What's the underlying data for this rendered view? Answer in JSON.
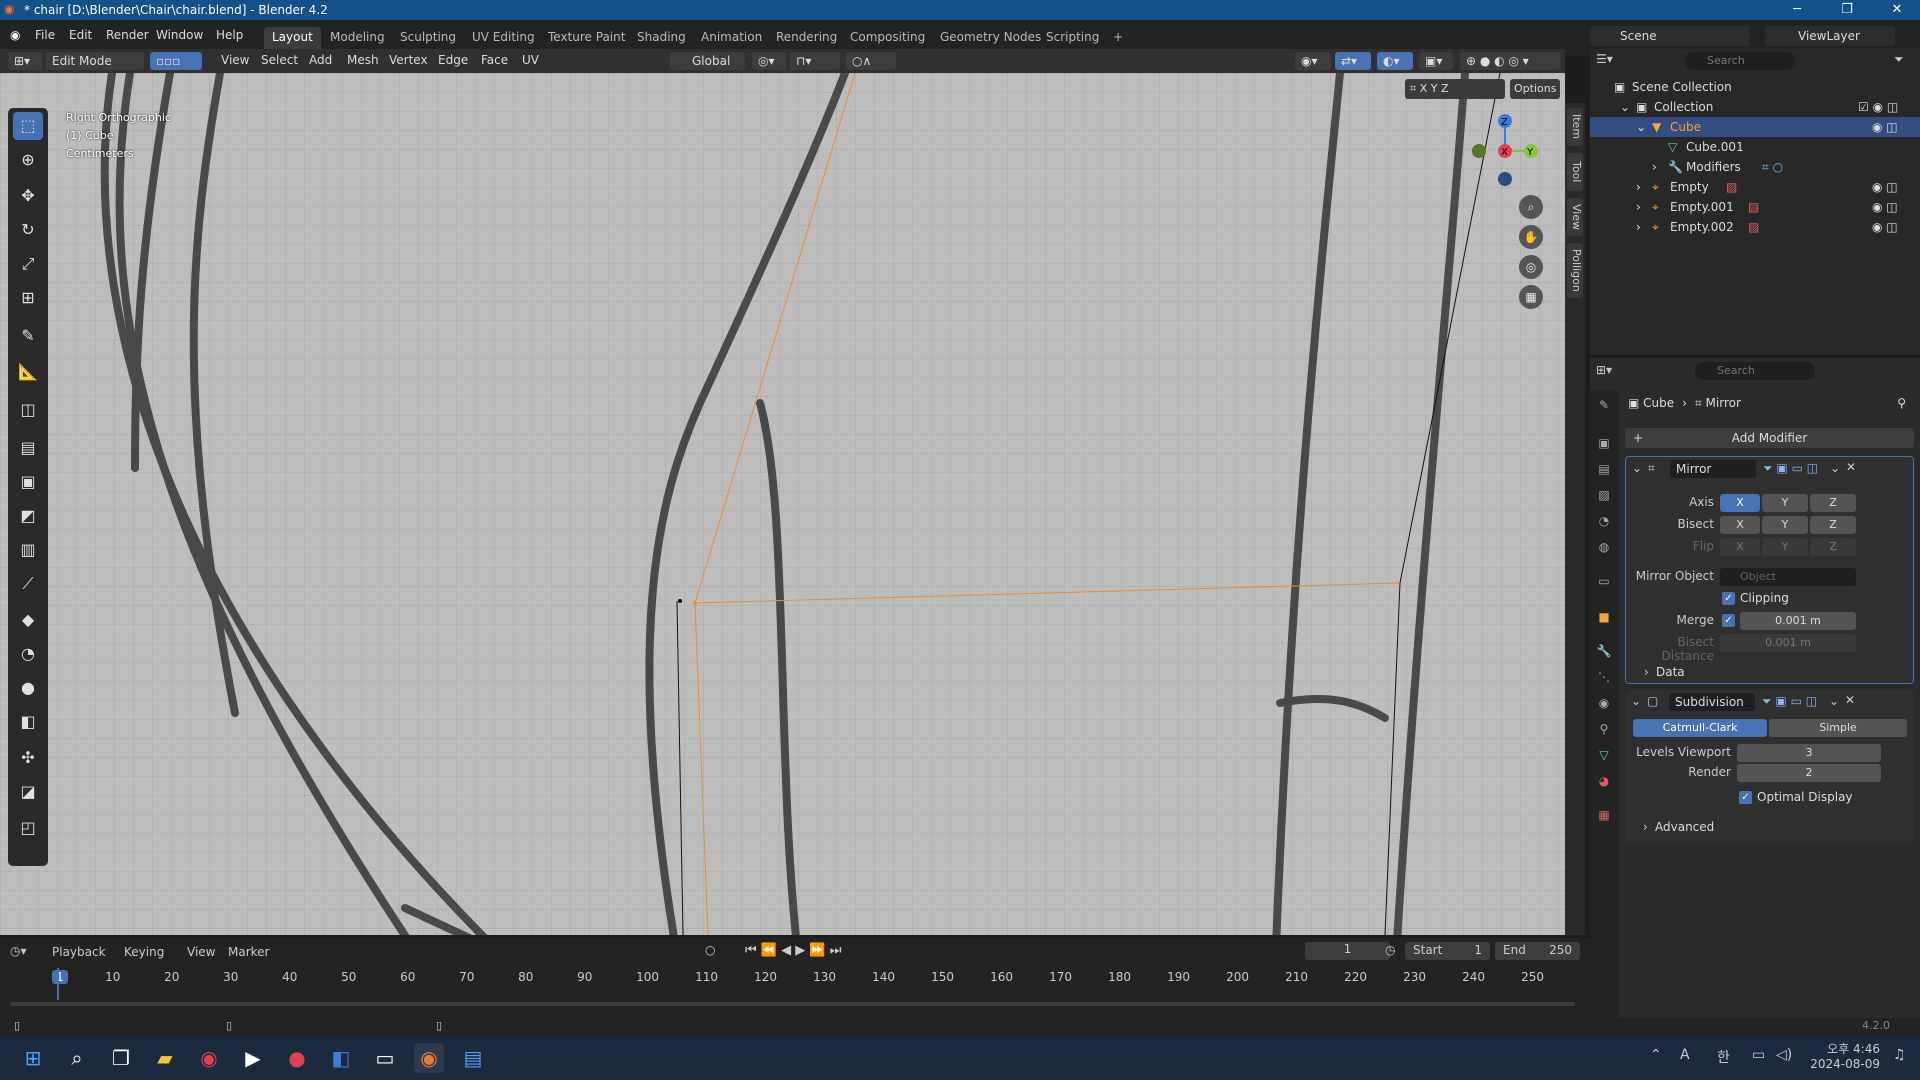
{
  "title_bar": {
    "title": "* chair [D:\\Blender\\Chair\\chair.blend] - Blender 4.2",
    "minimize": "─",
    "maximize": "❐",
    "close": "✕"
  },
  "menu": [
    "File",
    "Edit",
    "Render",
    "Window",
    "Help"
  ],
  "workspaces": [
    "Layout",
    "Modeling",
    "Sculpting",
    "UV Editing",
    "Texture Paint",
    "Shading",
    "Animation",
    "Rendering",
    "Compositing",
    "Geometry Nodes",
    "Scripting",
    "+"
  ],
  "active_workspace": "Layout",
  "scene": "Scene",
  "view_layer": "ViewLayer",
  "viewport_header": {
    "mode": "Edit Mode",
    "menus": [
      "View",
      "Select",
      "Add",
      "Mesh",
      "Vertex",
      "Edge",
      "Face",
      "UV"
    ],
    "transform": "Global",
    "options": "Options",
    "axes": [
      "X",
      "Y",
      "Z"
    ]
  },
  "overlay_text": [
    "Right Orthographic",
    "(1) Cube",
    "Centimeters"
  ],
  "side_tabs": [
    "Item",
    "Tool",
    "View",
    "Polligon"
  ],
  "outliner": {
    "search_placeholder": "Search",
    "root": "Scene Collection",
    "items": [
      {
        "name": "Collection"
      },
      {
        "name": "Cube",
        "selected": true
      },
      {
        "name": "Cube.001"
      },
      {
        "name": "Modifiers"
      },
      {
        "name": "Empty"
      },
      {
        "name": "Empty.001"
      },
      {
        "name": "Empty.002"
      }
    ]
  },
  "properties": {
    "search_placeholder": "Search",
    "breadcrumb": [
      "Cube",
      "Mirror"
    ],
    "add_modifier": "Add Modifier",
    "mirror": {
      "name": "Mirror",
      "axis_label": "Axis",
      "bisect_label": "Bisect",
      "flip_label": "Flip",
      "axes": [
        "X",
        "Y",
        "Z"
      ],
      "mirror_object_label": "Mirror Object",
      "mirror_object_placeholder": "Object",
      "clipping": "Clipping",
      "merge_label": "Merge",
      "merge_value": "0.001 m",
      "bisect_distance_label": "Bisect Distance",
      "bisect_distance_value": "0.001 m",
      "data": "Data"
    },
    "subdivision": {
      "name": "Subdivision",
      "catmull": "Catmull-Clark",
      "simple": "Simple",
      "levels_label": "Levels Viewport",
      "levels_value": "3",
      "render_label": "Render",
      "render_value": "2",
      "optimal": "Optimal Display",
      "advanced": "Advanced"
    }
  },
  "timeline": {
    "menus": [
      "Playback",
      "Keying",
      "View",
      "Marker"
    ],
    "current_frame": "1",
    "start_label": "Start",
    "start": "1",
    "end_label": "End",
    "end": "250",
    "ticks": [
      "1",
      "10",
      "20",
      "30",
      "40",
      "50",
      "60",
      "70",
      "80",
      "90",
      "100",
      "110",
      "120",
      "130",
      "140",
      "150",
      "160",
      "170",
      "180",
      "190",
      "200",
      "210",
      "220",
      "230",
      "240",
      "250"
    ]
  },
  "status_version": "4.2.0",
  "taskbar": {
    "time": "오후 4:46",
    "date": "2024-08-09",
    "ime": "A",
    "ime2": "한"
  }
}
